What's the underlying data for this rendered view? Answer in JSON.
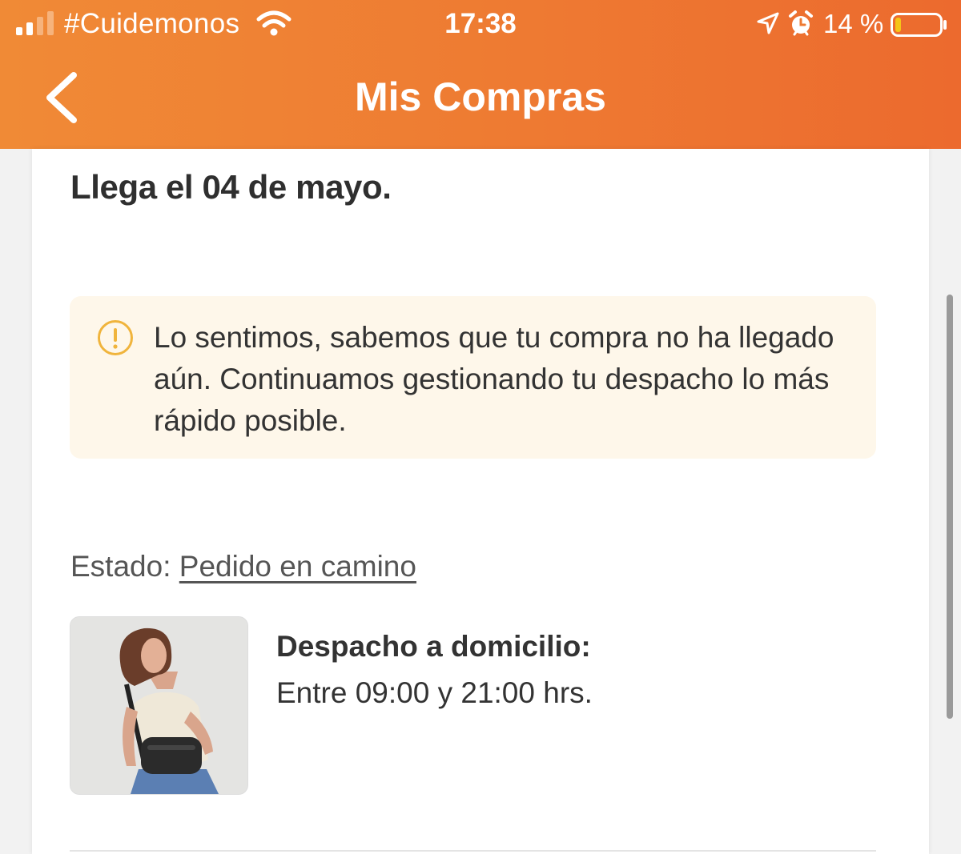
{
  "status_bar": {
    "carrier": "#Cuidemonos",
    "time": "17:38",
    "battery_text": "14 %",
    "battery_level": 0.14,
    "icons": [
      "signal-icon",
      "wifi-icon",
      "location-arrow-icon",
      "alarm-icon",
      "battery-icon"
    ]
  },
  "nav": {
    "back_icon": "chevron-left-icon",
    "title": "Mis Compras"
  },
  "order": {
    "arrival_text": "Llega el 04 de mayo.",
    "notice": {
      "icon": "warning-circle-icon",
      "text": "Lo sentimos, sabemos que tu compra no ha llegado aún. Continuamos gestionando tu despacho lo más rápido posible."
    },
    "status_label": "Estado:",
    "status_value": "Pedido en camino",
    "delivery_title": "Despacho a domicilio:",
    "delivery_window": "Entre 09:00 y 21:00 hrs."
  },
  "colors": {
    "header_start": "#f08a36",
    "header_end": "#ec6a2e",
    "notice_bg": "#fef7ea",
    "warning_icon": "#f0b43c",
    "battery_fill": "#f5c518"
  }
}
